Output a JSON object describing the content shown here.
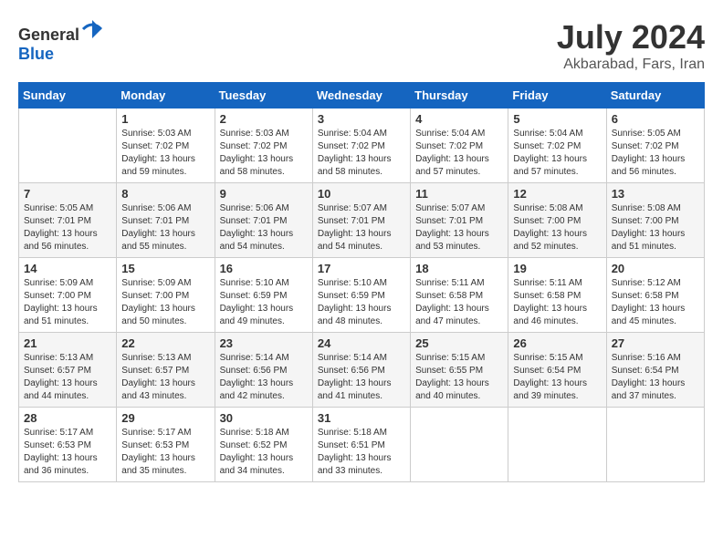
{
  "header": {
    "logo": {
      "text_general": "General",
      "text_blue": "Blue"
    },
    "title": "July 2024",
    "location": "Akbarabad, Fars, Iran"
  },
  "calendar": {
    "days_of_week": [
      "Sunday",
      "Monday",
      "Tuesday",
      "Wednesday",
      "Thursday",
      "Friday",
      "Saturday"
    ],
    "weeks": [
      [
        {
          "day": "",
          "sunrise": "",
          "sunset": "",
          "daylight": ""
        },
        {
          "day": "1",
          "sunrise": "Sunrise: 5:03 AM",
          "sunset": "Sunset: 7:02 PM",
          "daylight": "Daylight: 13 hours and 59 minutes."
        },
        {
          "day": "2",
          "sunrise": "Sunrise: 5:03 AM",
          "sunset": "Sunset: 7:02 PM",
          "daylight": "Daylight: 13 hours and 58 minutes."
        },
        {
          "day": "3",
          "sunrise": "Sunrise: 5:04 AM",
          "sunset": "Sunset: 7:02 PM",
          "daylight": "Daylight: 13 hours and 58 minutes."
        },
        {
          "day": "4",
          "sunrise": "Sunrise: 5:04 AM",
          "sunset": "Sunset: 7:02 PM",
          "daylight": "Daylight: 13 hours and 57 minutes."
        },
        {
          "day": "5",
          "sunrise": "Sunrise: 5:04 AM",
          "sunset": "Sunset: 7:02 PM",
          "daylight": "Daylight: 13 hours and 57 minutes."
        },
        {
          "day": "6",
          "sunrise": "Sunrise: 5:05 AM",
          "sunset": "Sunset: 7:02 PM",
          "daylight": "Daylight: 13 hours and 56 minutes."
        }
      ],
      [
        {
          "day": "7",
          "sunrise": "Sunrise: 5:05 AM",
          "sunset": "Sunset: 7:01 PM",
          "daylight": "Daylight: 13 hours and 56 minutes."
        },
        {
          "day": "8",
          "sunrise": "Sunrise: 5:06 AM",
          "sunset": "Sunset: 7:01 PM",
          "daylight": "Daylight: 13 hours and 55 minutes."
        },
        {
          "day": "9",
          "sunrise": "Sunrise: 5:06 AM",
          "sunset": "Sunset: 7:01 PM",
          "daylight": "Daylight: 13 hours and 54 minutes."
        },
        {
          "day": "10",
          "sunrise": "Sunrise: 5:07 AM",
          "sunset": "Sunset: 7:01 PM",
          "daylight": "Daylight: 13 hours and 54 minutes."
        },
        {
          "day": "11",
          "sunrise": "Sunrise: 5:07 AM",
          "sunset": "Sunset: 7:01 PM",
          "daylight": "Daylight: 13 hours and 53 minutes."
        },
        {
          "day": "12",
          "sunrise": "Sunrise: 5:08 AM",
          "sunset": "Sunset: 7:00 PM",
          "daylight": "Daylight: 13 hours and 52 minutes."
        },
        {
          "day": "13",
          "sunrise": "Sunrise: 5:08 AM",
          "sunset": "Sunset: 7:00 PM",
          "daylight": "Daylight: 13 hours and 51 minutes."
        }
      ],
      [
        {
          "day": "14",
          "sunrise": "Sunrise: 5:09 AM",
          "sunset": "Sunset: 7:00 PM",
          "daylight": "Daylight: 13 hours and 51 minutes."
        },
        {
          "day": "15",
          "sunrise": "Sunrise: 5:09 AM",
          "sunset": "Sunset: 7:00 PM",
          "daylight": "Daylight: 13 hours and 50 minutes."
        },
        {
          "day": "16",
          "sunrise": "Sunrise: 5:10 AM",
          "sunset": "Sunset: 6:59 PM",
          "daylight": "Daylight: 13 hours and 49 minutes."
        },
        {
          "day": "17",
          "sunrise": "Sunrise: 5:10 AM",
          "sunset": "Sunset: 6:59 PM",
          "daylight": "Daylight: 13 hours and 48 minutes."
        },
        {
          "day": "18",
          "sunrise": "Sunrise: 5:11 AM",
          "sunset": "Sunset: 6:58 PM",
          "daylight": "Daylight: 13 hours and 47 minutes."
        },
        {
          "day": "19",
          "sunrise": "Sunrise: 5:11 AM",
          "sunset": "Sunset: 6:58 PM",
          "daylight": "Daylight: 13 hours and 46 minutes."
        },
        {
          "day": "20",
          "sunrise": "Sunrise: 5:12 AM",
          "sunset": "Sunset: 6:58 PM",
          "daylight": "Daylight: 13 hours and 45 minutes."
        }
      ],
      [
        {
          "day": "21",
          "sunrise": "Sunrise: 5:13 AM",
          "sunset": "Sunset: 6:57 PM",
          "daylight": "Daylight: 13 hours and 44 minutes."
        },
        {
          "day": "22",
          "sunrise": "Sunrise: 5:13 AM",
          "sunset": "Sunset: 6:57 PM",
          "daylight": "Daylight: 13 hours and 43 minutes."
        },
        {
          "day": "23",
          "sunrise": "Sunrise: 5:14 AM",
          "sunset": "Sunset: 6:56 PM",
          "daylight": "Daylight: 13 hours and 42 minutes."
        },
        {
          "day": "24",
          "sunrise": "Sunrise: 5:14 AM",
          "sunset": "Sunset: 6:56 PM",
          "daylight": "Daylight: 13 hours and 41 minutes."
        },
        {
          "day": "25",
          "sunrise": "Sunrise: 5:15 AM",
          "sunset": "Sunset: 6:55 PM",
          "daylight": "Daylight: 13 hours and 40 minutes."
        },
        {
          "day": "26",
          "sunrise": "Sunrise: 5:15 AM",
          "sunset": "Sunset: 6:54 PM",
          "daylight": "Daylight: 13 hours and 39 minutes."
        },
        {
          "day": "27",
          "sunrise": "Sunrise: 5:16 AM",
          "sunset": "Sunset: 6:54 PM",
          "daylight": "Daylight: 13 hours and 37 minutes."
        }
      ],
      [
        {
          "day": "28",
          "sunrise": "Sunrise: 5:17 AM",
          "sunset": "Sunset: 6:53 PM",
          "daylight": "Daylight: 13 hours and 36 minutes."
        },
        {
          "day": "29",
          "sunrise": "Sunrise: 5:17 AM",
          "sunset": "Sunset: 6:53 PM",
          "daylight": "Daylight: 13 hours and 35 minutes."
        },
        {
          "day": "30",
          "sunrise": "Sunrise: 5:18 AM",
          "sunset": "Sunset: 6:52 PM",
          "daylight": "Daylight: 13 hours and 34 minutes."
        },
        {
          "day": "31",
          "sunrise": "Sunrise: 5:18 AM",
          "sunset": "Sunset: 6:51 PM",
          "daylight": "Daylight: 13 hours and 33 minutes."
        },
        {
          "day": "",
          "sunrise": "",
          "sunset": "",
          "daylight": ""
        },
        {
          "day": "",
          "sunrise": "",
          "sunset": "",
          "daylight": ""
        },
        {
          "day": "",
          "sunrise": "",
          "sunset": "",
          "daylight": ""
        }
      ]
    ]
  }
}
